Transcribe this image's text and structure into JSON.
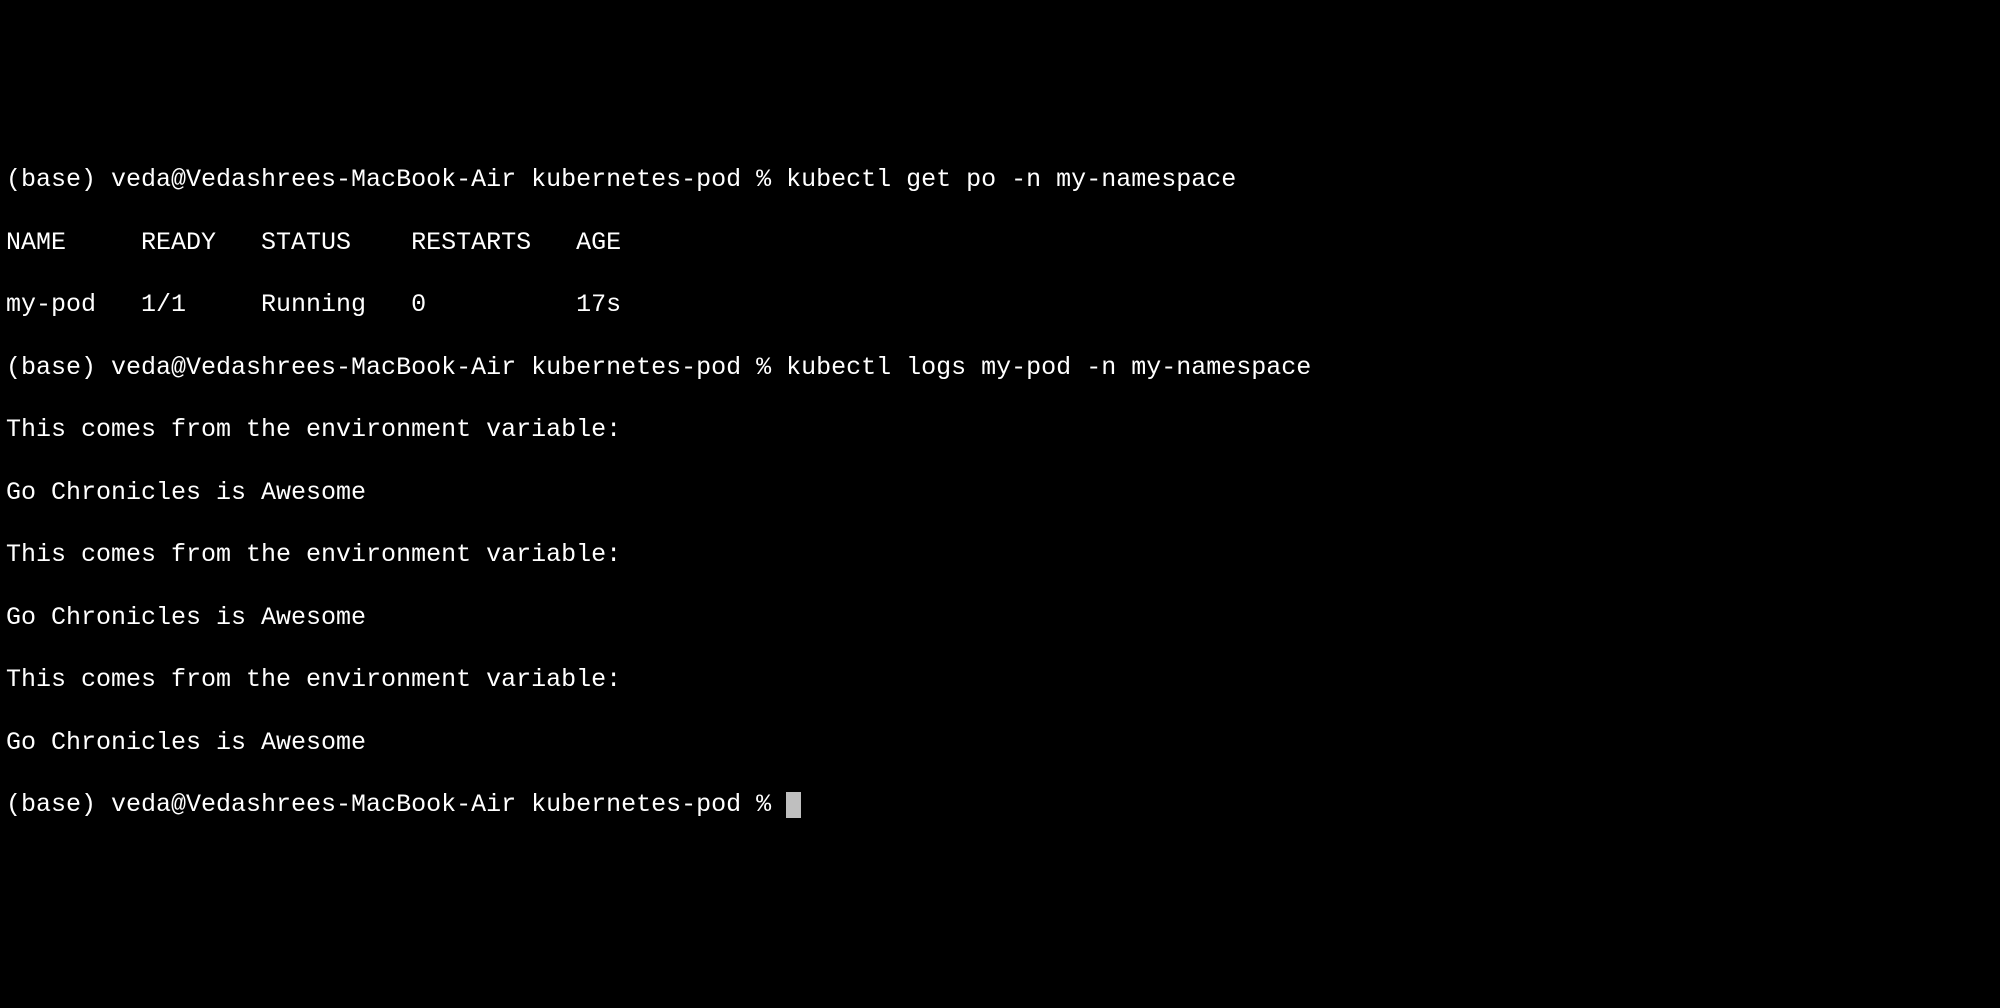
{
  "terminal": {
    "prompt_prefix": "(base) veda@Vedashrees-MacBook-Air kubernetes-pod % ",
    "commands": {
      "cmd1": "kubectl get po -n my-namespace",
      "cmd2": "kubectl logs my-pod -n my-namespace"
    },
    "table_header": "NAME     READY   STATUS    RESTARTS   AGE",
    "table_row": "my-pod   1/1     Running   0          17s",
    "log_lines": {
      "l0": "This comes from the environment variable:",
      "l1": "Go Chronicles is Awesome",
      "l2": "This comes from the environment variable:",
      "l3": "Go Chronicles is Awesome",
      "l4": "This comes from the environment variable:",
      "l5": "Go Chronicles is Awesome"
    }
  }
}
